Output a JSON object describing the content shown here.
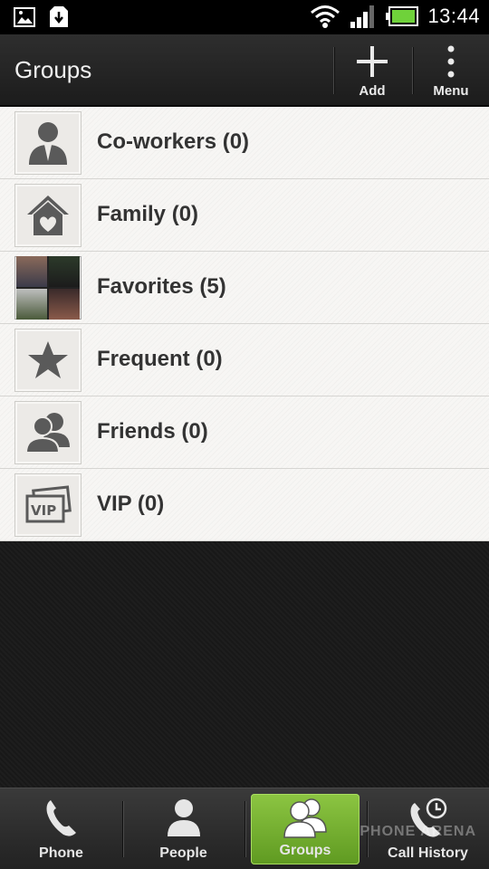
{
  "status_bar": {
    "time": "13:44",
    "icons": [
      "image-icon",
      "download-icon",
      "wifi-icon",
      "signal-icon",
      "battery-icon"
    ]
  },
  "action_bar": {
    "title": "Groups",
    "add_label": "Add",
    "menu_label": "Menu"
  },
  "groups": [
    {
      "label": "Co-workers (0)",
      "icon": "coworker-icon"
    },
    {
      "label": "Family (0)",
      "icon": "home-heart-icon"
    },
    {
      "label": "Favorites (5)",
      "icon": "photo-collage"
    },
    {
      "label": "Frequent (0)",
      "icon": "star-icon"
    },
    {
      "label": "Friends (0)",
      "icon": "friends-icon"
    },
    {
      "label": "VIP (0)",
      "icon": "vip-icon"
    }
  ],
  "tabs": [
    {
      "label": "Phone",
      "icon": "phone-icon",
      "active": false
    },
    {
      "label": "People",
      "icon": "person-icon",
      "active": false
    },
    {
      "label": "Groups",
      "icon": "group-icon",
      "active": true
    },
    {
      "label": "Call History",
      "icon": "call-history-icon",
      "active": false
    }
  ],
  "watermark": "PHONE ARENA",
  "colors": {
    "active_tab": "#7ab834",
    "list_bg": "#f6f5f3",
    "label_text": "#333333"
  }
}
